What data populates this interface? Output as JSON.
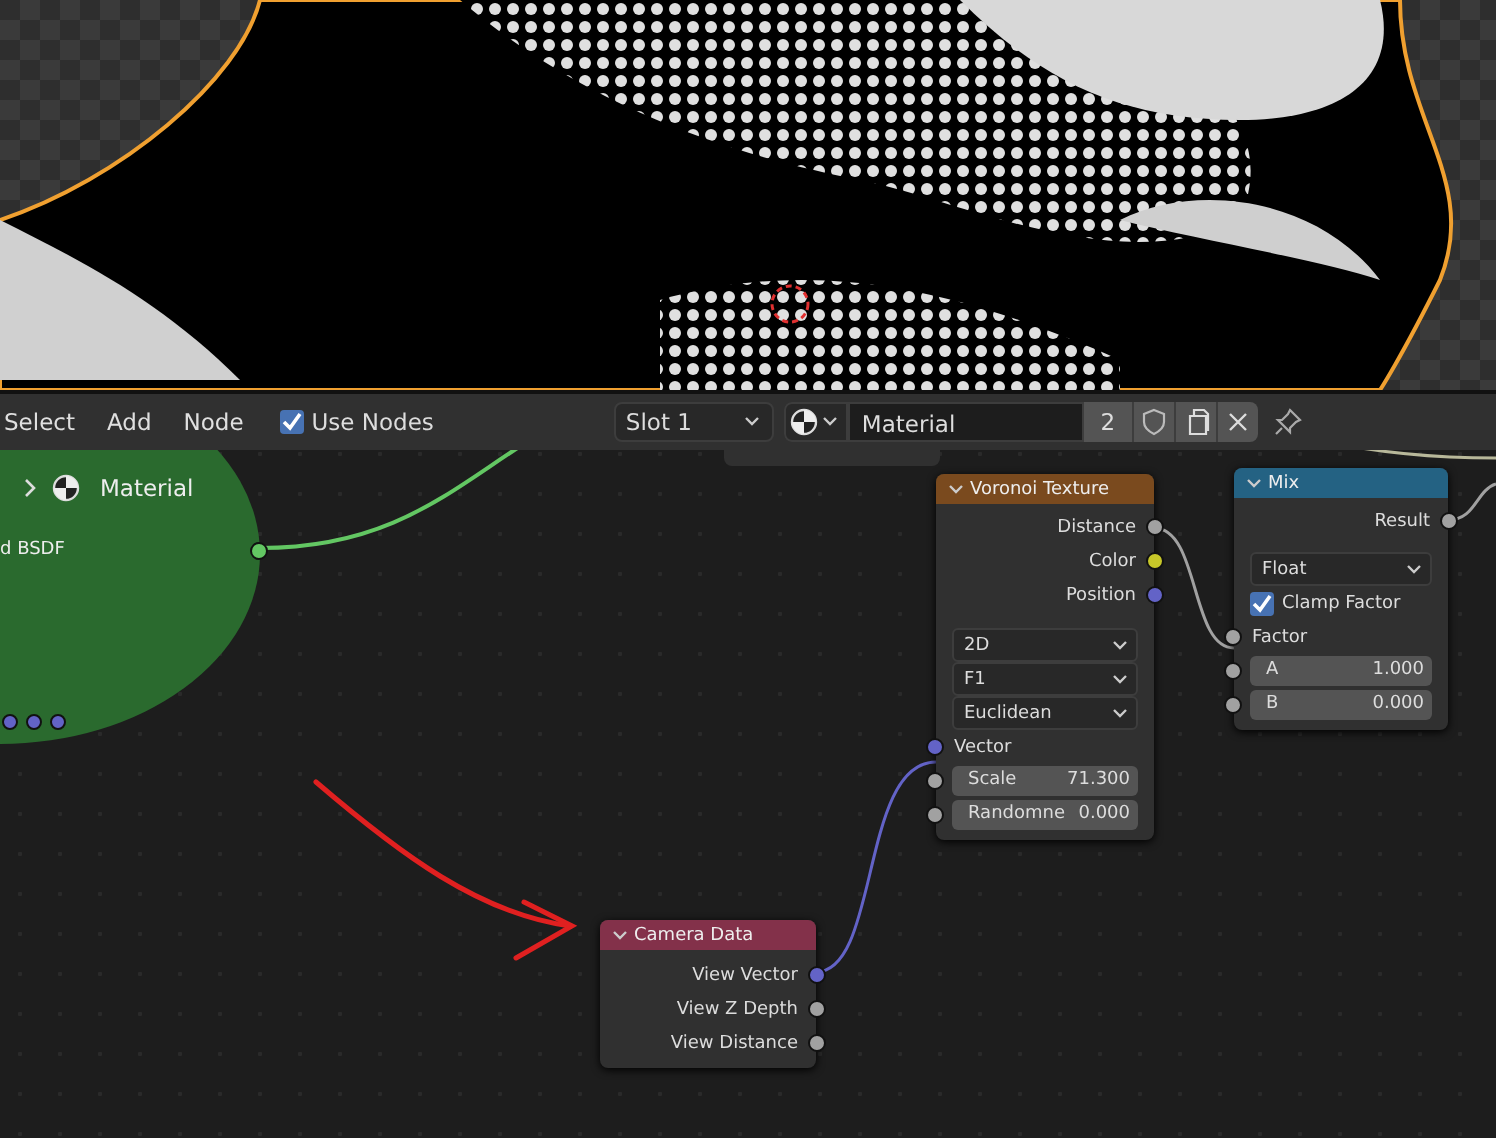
{
  "header": {
    "menus": [
      "Select",
      "Add",
      "Node"
    ],
    "use_nodes": {
      "label": "Use Nodes",
      "checked": true
    },
    "slot": "Slot 1",
    "material": "Material",
    "users": "2"
  },
  "nodes": [
    {
      "kind": "shader",
      "title": "Material",
      "socket": {
        "label": "d BSDF",
        "color": "#63c763"
      }
    },
    {
      "kind": "texture",
      "title": "Voronoi Texture",
      "rows": [
        {
          "kind": "output",
          "label": "Distance",
          "color": "#a1a1a1"
        },
        {
          "kind": "output",
          "label": "Color",
          "color": "#c7c729"
        },
        {
          "kind": "output",
          "label": "Position",
          "color": "#6363c7"
        },
        {
          "kind": "dropdown",
          "value": "2D"
        },
        {
          "kind": "dropdown",
          "value": "F1"
        },
        {
          "kind": "dropdown",
          "value": "Euclidean"
        },
        {
          "kind": "input",
          "label": "Vector",
          "color": "#6363c7"
        },
        {
          "kind": "field",
          "label": "Scale",
          "value": "71.300",
          "color": "#a1a1a1"
        },
        {
          "kind": "field",
          "label": "Randomne",
          "value": "0.000",
          "color": "#a1a1a1"
        }
      ]
    },
    {
      "kind": "converter",
      "title": "Mix",
      "rows": [
        {
          "kind": "output",
          "label": "Result",
          "color": "#a1a1a1"
        },
        {
          "kind": "dropdown",
          "value": "Float"
        },
        {
          "kind": "checkbox",
          "label": "Clamp Factor",
          "checked": true
        },
        {
          "kind": "input",
          "label": "Factor",
          "color": "#a1a1a1"
        },
        {
          "kind": "field",
          "label": "A",
          "value": "1.000",
          "color": "#a1a1a1"
        },
        {
          "kind": "field",
          "label": "B",
          "value": "0.000",
          "color": "#a1a1a1"
        }
      ]
    },
    {
      "kind": "input",
      "title": "Camera Data",
      "rows": [
        {
          "kind": "output",
          "label": "View Vector",
          "color": "#6363c7"
        },
        {
          "kind": "output",
          "label": "View Z Depth",
          "color": "#a1a1a1"
        },
        {
          "kind": "output",
          "label": "View Distance",
          "color": "#a1a1a1"
        }
      ]
    }
  ]
}
